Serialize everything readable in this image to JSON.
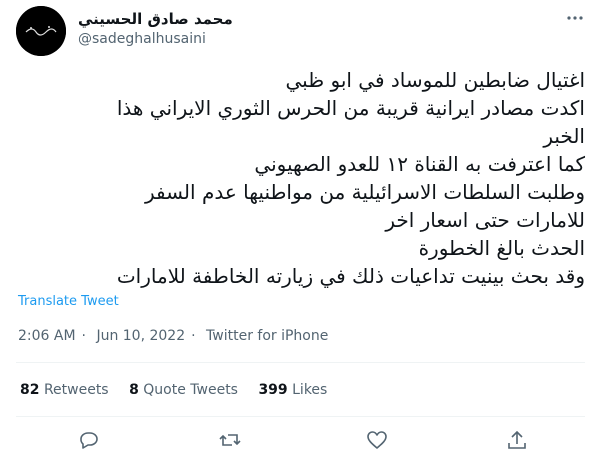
{
  "author": {
    "display_name": "محمد صادق الحسيني",
    "handle": "@sadeghalhusaini"
  },
  "tweet": {
    "lines": [
      "اغتيال ضابطين للموساد في ابو ظبي",
      "اكدت مصادر ايرانية قريبة من الحرس الثوري الايراني هذا",
      "الخبر",
      "كما اعترفت به القناة ١٢ للعدو الصهيوني",
      "وطلبت السلطات الاسرائيلية من مواطنيها عدم السفر",
      "للامارات حتى اسعار اخر",
      "الحدث بالغ الخطورة",
      "وقد بحث بينيت تداعيات ذلك في زيارته الخاطفة للامارات"
    ],
    "translate_label": "Translate Tweet"
  },
  "meta": {
    "time": "2:06 AM",
    "sep1": "·",
    "date": "Jun 10, 2022",
    "sep2": "·",
    "source": "Twitter for iPhone"
  },
  "stats": {
    "retweets_count": "82",
    "retweets_label": "Retweets",
    "quotes_count": "8",
    "quotes_label": "Quote Tweets",
    "likes_count": "399",
    "likes_label": "Likes"
  },
  "icons": {
    "reply": "reply-icon",
    "retweet": "retweet-icon",
    "like": "heart-icon",
    "share": "share-icon",
    "more": "more-icon"
  },
  "colors": {
    "text": "#0f1419",
    "secondary": "#536471",
    "link": "#1d9bf0",
    "divider": "#eff3f4"
  }
}
